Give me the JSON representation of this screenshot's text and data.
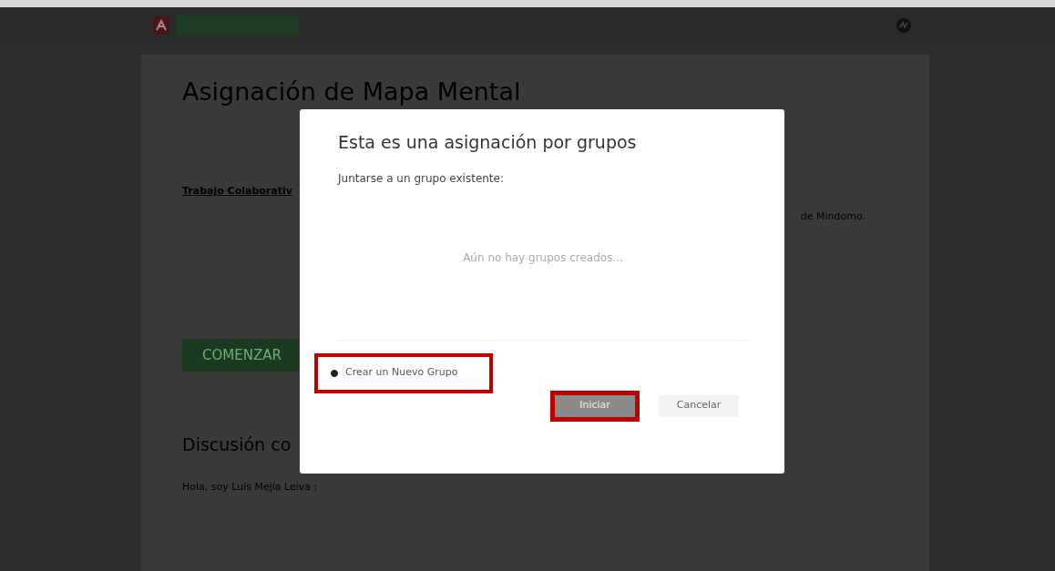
{
  "page": {
    "title": "Asignación de Mapa Mental",
    "section_heading": "Trabajo Colaborativ",
    "text_fragment": "de Mindomo.",
    "start_button": "COMENZAR",
    "discussion_heading": "Discusión co",
    "greeting": "Hola, soy Luis Mejía Leiva :"
  },
  "dialog": {
    "title": "Esta es una asignación por grupos",
    "join_label": "Juntarse a un grupo existente:",
    "empty_message": "Aún no hay grupos creados...",
    "options": [
      {
        "label": "Crear un Nuevo Grupo",
        "selected": true,
        "highlighted": true
      }
    ],
    "buttons": [
      {
        "label": "Iniciar",
        "kind": "primary",
        "highlighted": true
      },
      {
        "label": "Cancelar",
        "kind": "secondary",
        "highlighted": false
      }
    ]
  }
}
